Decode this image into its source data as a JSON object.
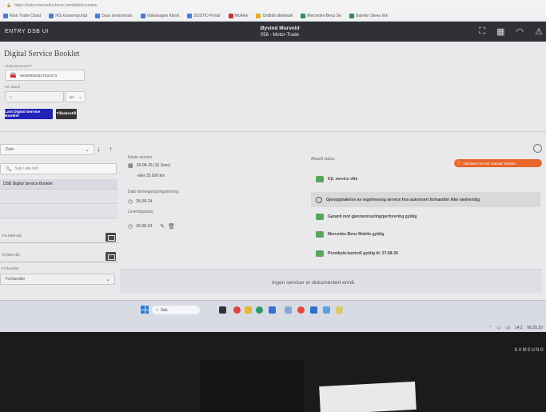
{
  "browser": {
    "url": "https://entry.mercedes-benz.com/dsb/overview",
    "bookmarks": [
      "Ram Trade Cloud",
      "IKS konsernportal",
      "Dass serviceinsis",
      "Volkswagen Klient",
      "SOSTIO Portal",
      "McAfee",
      "Ordbild direktsøk",
      "Mercedes-Benz Se",
      "Daimler Stees link"
    ]
  },
  "header": {
    "brand": "ENTRY DSB UI",
    "user_name": "Øyvind Murvold",
    "user_company": "056 - Motor-Trade"
  },
  "form": {
    "title": "Digital Service Booklet",
    "vin_label": "Chassisnummer*",
    "vin_value": "WDB9906384TR23273",
    "km_label": "Km stand",
    "km_value": "0",
    "km_unit": "km",
    "primary_button": "Last Digital Service Booklet",
    "secondary_button": "Tilbakestill"
  },
  "filters": {
    "sort_select": "Dato",
    "search_placeholder": "Søk i alle felt",
    "list_item": "DSB Digital Service Booklet",
    "from_label": "Fra (MM-dd)",
    "to_label": "Til (MM-dd)",
    "dealer_label": "Forhandler",
    "dealer_value": "Forhandler"
  },
  "service": {
    "next_label": "Neste service",
    "next_date": "26-08-25 (15 User)",
    "next_km": "eller 25 000 km",
    "first_reg_label": "Dato førstegangsregistrering",
    "first_reg_value": "25-08-24",
    "delivery_label": "Leveringsdato",
    "delivery_value": "25-08-24",
    "empty_text": "Ingen servicer er dokumentert ennå."
  },
  "status": {
    "title": "Aktuell status",
    "warning": "Ukritisert current manual Velutter...",
    "items": [
      "Kjt. service ofte",
      "Gjenopptakelse av regelmessig service hos autorisert forhandler ikke nødvendig",
      "Garanti mot gjennomrusting/perforering gyldig",
      "Mercedes-Benz Mobilo gyldig",
      "Prustkykt-kontroll gyldig til: 27-08-39"
    ]
  },
  "taskbar": {
    "search": "Søk",
    "time": "14:2",
    "date": "06.05.20"
  },
  "monitor": {
    "brand": "SAMSUNG"
  },
  "colors": {
    "primary": "#2222b8",
    "warning": "#e8662c",
    "ok": "#58a65a",
    "header": "#2f3136"
  }
}
